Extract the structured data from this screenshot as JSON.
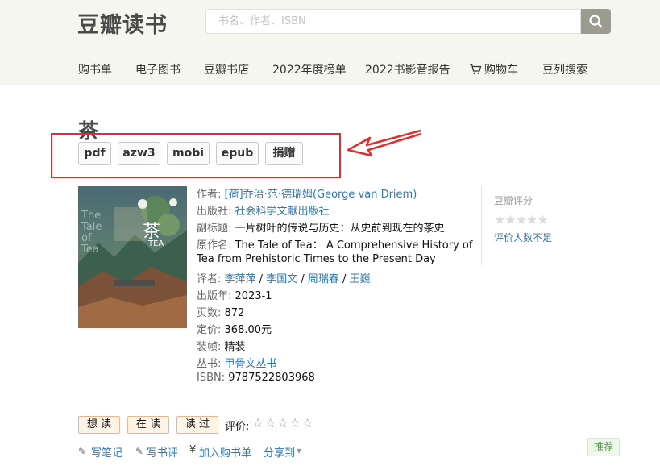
{
  "header": {
    "logo": "豆瓣读书",
    "search_placeholder": "书名、作者、ISBN"
  },
  "nav": {
    "items": [
      "购书单",
      "电子图书",
      "豆瓣书店",
      "2022年度榜单",
      "2022书影音报告",
      "购物车",
      "豆列搜索"
    ]
  },
  "book": {
    "title": "茶",
    "formats": [
      "pdf",
      "azw3",
      "mobi",
      "epub",
      "捐赠"
    ],
    "info": {
      "author_label": "作者:",
      "author": "[荷]乔治·范·德瑞姆(George van Driem)",
      "publisher_label": "出版社:",
      "publisher": "社会科学文献出版社",
      "subtitle_label": "副标题:",
      "subtitle": "一片树叶的传说与历史：从史前到现在的茶史",
      "original_label": "原作名:",
      "original_line1": "The Tale of Tea： A Comprehensive History of",
      "original_line2": "Tea from Prehistoric Times to the Present Day",
      "translator_label": "译者:",
      "translators": [
        "李萍萍",
        "李国文",
        "周瑞春",
        "王巍"
      ],
      "translator_sep": " / ",
      "pubyear_label": "出版年:",
      "pubyear": "2023-1",
      "pages_label": "页数:",
      "pages": "872",
      "price_label": "定价:",
      "price": "368.00元",
      "binding_label": "装帧:",
      "binding": "精装",
      "series_label": "丛书:",
      "series": "甲骨文丛书",
      "isbn_label": "ISBN:",
      "isbn": "9787522803968"
    },
    "cover_text": {
      "big_char": "茶",
      "en_title": "TEA",
      "side": "The Tale of Tea"
    }
  },
  "rating": {
    "title": "豆瓣评分",
    "stars": "★★★★★",
    "note": "评价人数不足"
  },
  "actions": {
    "want_read": "想 读",
    "reading": "在 读",
    "read": "读 过",
    "rate_label": "评价:",
    "rate_stars": "☆☆☆☆☆"
  },
  "bottom": {
    "write_note": "写笔记",
    "write_review": "写书评",
    "add_cart": "加入购书单",
    "share": "分享到",
    "recommend": "推荐"
  },
  "colors": {
    "link": "#3377aa",
    "annotation_red": "#e02d2d",
    "header_bg": "#f6f6f1"
  }
}
